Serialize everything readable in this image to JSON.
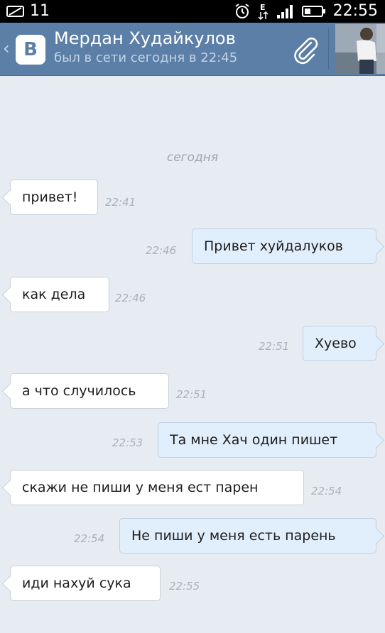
{
  "status_bar": {
    "notifications": "11",
    "clock": "22:55",
    "network": "E"
  },
  "header": {
    "logo": "B",
    "name": "Мердан Худайкулов",
    "status": "был в сети сегодня в 22:45"
  },
  "date_separator": "сегодня",
  "messages": [
    {
      "direction": "in",
      "text": "привет!",
      "time": "22:41"
    },
    {
      "direction": "out",
      "text": "Привет хуйдалуков",
      "time": "22:46"
    },
    {
      "direction": "in",
      "text": "как дела",
      "time": "22:46"
    },
    {
      "direction": "out",
      "text": "Хуево",
      "time": "22:51"
    },
    {
      "direction": "in",
      "text": "а что случилось",
      "time": "22:51"
    },
    {
      "direction": "out",
      "text": "Та мне Хач один пишет",
      "time": "22:53"
    },
    {
      "direction": "in",
      "text": "скажи не пиши у меня ест парен",
      "time": "22:54"
    },
    {
      "direction": "out",
      "text": "Не пиши у меня есть парень",
      "time": "22:54"
    },
    {
      "direction": "in",
      "text": "иди нахуй сука",
      "time": "22:55"
    }
  ],
  "colors": {
    "header_bg": "#5b7fa6",
    "chat_bg": "#e7ecf2",
    "incoming_bubble": "#ffffff",
    "outgoing_bubble": "#e1eefb"
  }
}
